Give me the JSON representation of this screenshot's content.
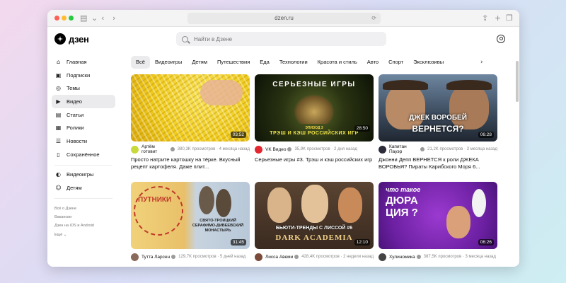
{
  "browser": {
    "url": "dzen.ru"
  },
  "header": {
    "logo_text": "дзен",
    "search_placeholder": "Найти в Дзене"
  },
  "sidebar": {
    "items": [
      {
        "label": "Главная",
        "icon": "home-icon",
        "glyph": "⌂"
      },
      {
        "label": "Подписки",
        "icon": "subscriptions-icon",
        "glyph": "▣"
      },
      {
        "label": "Темы",
        "icon": "compass-icon",
        "glyph": "◎"
      },
      {
        "label": "Видео",
        "icon": "play-icon",
        "glyph": "▶",
        "active": true
      },
      {
        "label": "Статьи",
        "icon": "article-icon",
        "glyph": "▤"
      },
      {
        "label": "Ролики",
        "icon": "shorts-icon",
        "glyph": "▦"
      },
      {
        "label": "Новости",
        "icon": "news-icon",
        "glyph": "☰"
      },
      {
        "label": "Сохранённое",
        "icon": "bookmark-icon",
        "glyph": "▯"
      }
    ],
    "extra_items": [
      {
        "label": "Видеоигры",
        "icon": "gamepad-icon",
        "glyph": "◐"
      },
      {
        "label": "Детям",
        "icon": "kids-icon",
        "glyph": "☺"
      }
    ],
    "footer_links": [
      "Всё о Дзене",
      "Вакансии",
      "Дзен на iOS и Android",
      "Ещё"
    ]
  },
  "categories": [
    "Всё",
    "Видеоигры",
    "Детям",
    "Путешествия",
    "Еда",
    "Технологии",
    "Красота и стиль",
    "Авто",
    "Спорт",
    "Эксклюзивы"
  ],
  "videos": [
    {
      "thumb_text": "",
      "duration": "03:52",
      "channel": "Артём готовит",
      "stats": "380,3K просмотров · 4 месяца назад",
      "title": "Просто натрите картошку на тёрке. Вкусный рецепт картофеля. Даже плит...",
      "avatar_color": "#c9d93a"
    },
    {
      "thumb_text": "СЕРЬЕЗНЫЕ ИГРЫ",
      "thumb_text2": "ТРЭШ И КЭШ РОССИЙСКИХ ИГР",
      "thumb_text3": "ЭПИЗОД 3",
      "duration": "28:50",
      "channel": "VK Видео",
      "stats": "35,9K просмотров · 2 дня назад",
      "title": "Серьезные игры #3. Трэш и кэш российских игр",
      "avatar_color": "#e3262f"
    },
    {
      "thumb_text": "ДЖЕК ВОРОБЕЙ",
      "thumb_text2": "ВЕРНЕТСЯ?",
      "duration": "06:28",
      "channel": "Капитан Пауэр",
      "stats": "21,2K просмотров · 3 месяца назад",
      "title": "Джонни Депп ВЕРНЕТСЯ к роли ДЖЕКА ВОРОБЬЯ? Пираты Карибского Моря 6...",
      "avatar_color": "#2b2b3a"
    },
    {
      "thumb_text": "ПУТНИКИ",
      "thumb_text2": "СВЯТО-ТРОИЦКИЙ СЕРАФИМО-ДИВЕЕВСКИЙ МОНАСТЫРЬ",
      "duration": "31:45",
      "channel": "Тутта Ларсен",
      "stats": "129,7K просмотров · 5 дней назад",
      "title": "",
      "avatar_color": "#8a6a5a"
    },
    {
      "thumb_text": "БЬЮТИ-ТРЕНДЫ С ЛИССОЙ #6",
      "thumb_text2": "DARK ACADEMIA",
      "duration": "12:10",
      "channel": "Лисса Авеми",
      "stats": "428,4K просмотров · 2 недели назад",
      "title": "",
      "avatar_color": "#7a4a3a"
    },
    {
      "thumb_text": "что такое",
      "thumb_text2": "ДЮРА ЦИЯ ?",
      "duration": "06:26",
      "channel": "Хулиномика",
      "stats": "387,5K просмотров · 3 месяца назад",
      "title": "",
      "avatar_color": "#444"
    }
  ]
}
